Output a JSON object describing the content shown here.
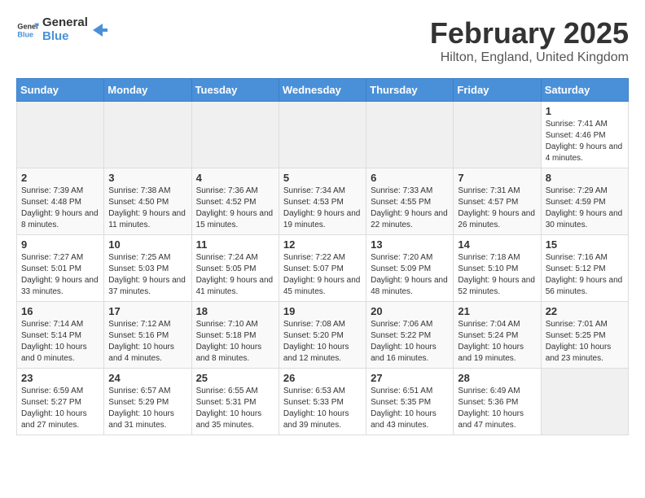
{
  "header": {
    "logo_general": "General",
    "logo_blue": "Blue",
    "month": "February 2025",
    "location": "Hilton, England, United Kingdom"
  },
  "days_of_week": [
    "Sunday",
    "Monday",
    "Tuesday",
    "Wednesday",
    "Thursday",
    "Friday",
    "Saturday"
  ],
  "weeks": [
    {
      "cells": [
        {
          "day": "",
          "info": ""
        },
        {
          "day": "",
          "info": ""
        },
        {
          "day": "",
          "info": ""
        },
        {
          "day": "",
          "info": ""
        },
        {
          "day": "",
          "info": ""
        },
        {
          "day": "",
          "info": ""
        },
        {
          "day": "1",
          "info": "Sunrise: 7:41 AM\nSunset: 4:46 PM\nDaylight: 9 hours and 4 minutes."
        }
      ]
    },
    {
      "cells": [
        {
          "day": "2",
          "info": "Sunrise: 7:39 AM\nSunset: 4:48 PM\nDaylight: 9 hours and 8 minutes."
        },
        {
          "day": "3",
          "info": "Sunrise: 7:38 AM\nSunset: 4:50 PM\nDaylight: 9 hours and 11 minutes."
        },
        {
          "day": "4",
          "info": "Sunrise: 7:36 AM\nSunset: 4:52 PM\nDaylight: 9 hours and 15 minutes."
        },
        {
          "day": "5",
          "info": "Sunrise: 7:34 AM\nSunset: 4:53 PM\nDaylight: 9 hours and 19 minutes."
        },
        {
          "day": "6",
          "info": "Sunrise: 7:33 AM\nSunset: 4:55 PM\nDaylight: 9 hours and 22 minutes."
        },
        {
          "day": "7",
          "info": "Sunrise: 7:31 AM\nSunset: 4:57 PM\nDaylight: 9 hours and 26 minutes."
        },
        {
          "day": "8",
          "info": "Sunrise: 7:29 AM\nSunset: 4:59 PM\nDaylight: 9 hours and 30 minutes."
        }
      ]
    },
    {
      "cells": [
        {
          "day": "9",
          "info": "Sunrise: 7:27 AM\nSunset: 5:01 PM\nDaylight: 9 hours and 33 minutes."
        },
        {
          "day": "10",
          "info": "Sunrise: 7:25 AM\nSunset: 5:03 PM\nDaylight: 9 hours and 37 minutes."
        },
        {
          "day": "11",
          "info": "Sunrise: 7:24 AM\nSunset: 5:05 PM\nDaylight: 9 hours and 41 minutes."
        },
        {
          "day": "12",
          "info": "Sunrise: 7:22 AM\nSunset: 5:07 PM\nDaylight: 9 hours and 45 minutes."
        },
        {
          "day": "13",
          "info": "Sunrise: 7:20 AM\nSunset: 5:09 PM\nDaylight: 9 hours and 48 minutes."
        },
        {
          "day": "14",
          "info": "Sunrise: 7:18 AM\nSunset: 5:10 PM\nDaylight: 9 hours and 52 minutes."
        },
        {
          "day": "15",
          "info": "Sunrise: 7:16 AM\nSunset: 5:12 PM\nDaylight: 9 hours and 56 minutes."
        }
      ]
    },
    {
      "cells": [
        {
          "day": "16",
          "info": "Sunrise: 7:14 AM\nSunset: 5:14 PM\nDaylight: 10 hours and 0 minutes."
        },
        {
          "day": "17",
          "info": "Sunrise: 7:12 AM\nSunset: 5:16 PM\nDaylight: 10 hours and 4 minutes."
        },
        {
          "day": "18",
          "info": "Sunrise: 7:10 AM\nSunset: 5:18 PM\nDaylight: 10 hours and 8 minutes."
        },
        {
          "day": "19",
          "info": "Sunrise: 7:08 AM\nSunset: 5:20 PM\nDaylight: 10 hours and 12 minutes."
        },
        {
          "day": "20",
          "info": "Sunrise: 7:06 AM\nSunset: 5:22 PM\nDaylight: 10 hours and 16 minutes."
        },
        {
          "day": "21",
          "info": "Sunrise: 7:04 AM\nSunset: 5:24 PM\nDaylight: 10 hours and 19 minutes."
        },
        {
          "day": "22",
          "info": "Sunrise: 7:01 AM\nSunset: 5:25 PM\nDaylight: 10 hours and 23 minutes."
        }
      ]
    },
    {
      "cells": [
        {
          "day": "23",
          "info": "Sunrise: 6:59 AM\nSunset: 5:27 PM\nDaylight: 10 hours and 27 minutes."
        },
        {
          "day": "24",
          "info": "Sunrise: 6:57 AM\nSunset: 5:29 PM\nDaylight: 10 hours and 31 minutes."
        },
        {
          "day": "25",
          "info": "Sunrise: 6:55 AM\nSunset: 5:31 PM\nDaylight: 10 hours and 35 minutes."
        },
        {
          "day": "26",
          "info": "Sunrise: 6:53 AM\nSunset: 5:33 PM\nDaylight: 10 hours and 39 minutes."
        },
        {
          "day": "27",
          "info": "Sunrise: 6:51 AM\nSunset: 5:35 PM\nDaylight: 10 hours and 43 minutes."
        },
        {
          "day": "28",
          "info": "Sunrise: 6:49 AM\nSunset: 5:36 PM\nDaylight: 10 hours and 47 minutes."
        },
        {
          "day": "",
          "info": ""
        }
      ]
    }
  ]
}
